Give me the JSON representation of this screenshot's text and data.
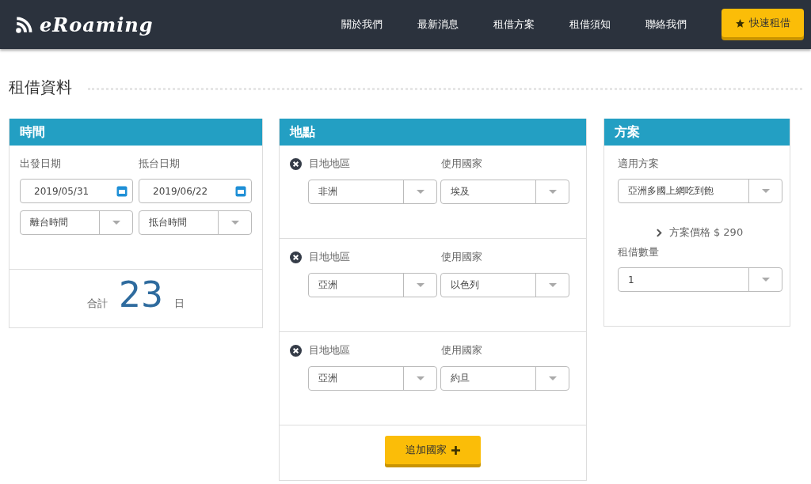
{
  "logo": {
    "text": "eRoaming"
  },
  "nav": {
    "items": [
      {
        "label": "關於我們"
      },
      {
        "label": "最新消息"
      },
      {
        "label": "租借方案"
      },
      {
        "label": "租借須知"
      },
      {
        "label": "聯絡我們"
      }
    ],
    "cta": "快速租借"
  },
  "page_title": "租借資料",
  "time_panel": {
    "title": "時間",
    "departure_label": "出發日期",
    "return_label": "抵台日期",
    "departure_date": "2019/05/31",
    "return_date": "2019/06/22",
    "departure_time": "離台時間",
    "return_time": "抵台時間",
    "total_label": "合計",
    "total_days": "23",
    "days_unit": "日"
  },
  "location_panel": {
    "title": "地點",
    "entries": [
      {
        "region_label": "目地地區",
        "country_label": "使用國家",
        "region": "非洲",
        "country": "埃及"
      },
      {
        "region_label": "目地地區",
        "country_label": "使用國家",
        "region": "亞洲",
        "country": "以色列"
      },
      {
        "region_label": "目地地區",
        "country_label": "使用國家",
        "region": "亞洲",
        "country": "約旦"
      }
    ],
    "add_button": "追加國家"
  },
  "plan_panel": {
    "title": "方案",
    "plan_label": "適用方案",
    "plan": "亞洲多國上網吃到飽",
    "price": "方案價格 $ 290",
    "quantity_label": "租借數量",
    "quantity": "1"
  }
}
